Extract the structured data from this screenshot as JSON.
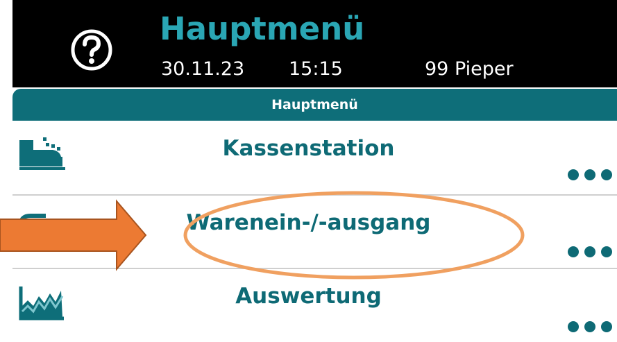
{
  "header": {
    "title": "Hauptmenü",
    "date": "30.11.23",
    "time": "15:15",
    "user": "99 Pieper"
  },
  "tab_bar": {
    "label": "Hauptmenü"
  },
  "menu": {
    "items": [
      {
        "label": "Kassenstation",
        "icon": "cash-register-icon"
      },
      {
        "label": "Warenein-/-ausgang",
        "icon": "goods-inout-icon"
      },
      {
        "label": "Auswertung",
        "icon": "chart-icon"
      }
    ]
  },
  "colors": {
    "title": "#2aa6b4",
    "accent": "#0e6e79",
    "annotation": "#f0883a"
  }
}
